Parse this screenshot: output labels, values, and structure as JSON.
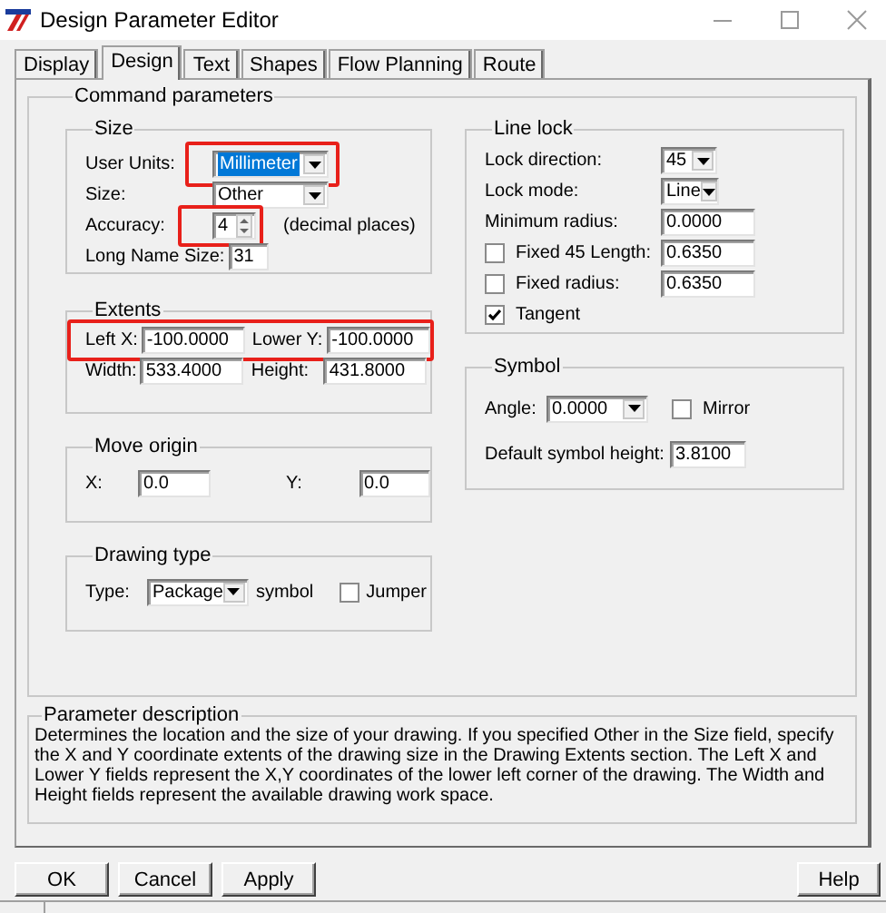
{
  "window": {
    "title": "Design Parameter Editor"
  },
  "tabs": [
    {
      "label": "Display",
      "selected": false
    },
    {
      "label": "Design",
      "selected": true
    },
    {
      "label": "Text",
      "selected": false
    },
    {
      "label": "Shapes",
      "selected": false
    },
    {
      "label": "Flow Planning",
      "selected": false
    },
    {
      "label": "Route",
      "selected": false
    }
  ],
  "command_parameters": {
    "title": "Command parameters"
  },
  "size": {
    "title": "Size",
    "rows": [
      {
        "kind": "dropdown",
        "label": "User Units:",
        "value": "Millimeter",
        "text_selected": true,
        "highlighted": true
      },
      {
        "kind": "dropdown",
        "label": "Size:",
        "value": "Other",
        "text_selected": false,
        "highlighted": false
      },
      {
        "kind": "spinner",
        "label": "Accuracy:",
        "value": "4",
        "suffix": "(decimal places)",
        "highlighted": true
      },
      {
        "kind": "input",
        "label": "Long Name Size:",
        "value": "31",
        "highlighted": false
      }
    ]
  },
  "extents": {
    "title": "Extents",
    "rows": [
      {
        "highlighted": true,
        "fields": [
          {
            "label": "Left X:",
            "value": "-100.0000"
          },
          {
            "label": "Lower Y:",
            "value": "-100.0000"
          }
        ]
      },
      {
        "highlighted": false,
        "fields": [
          {
            "label": "Width:",
            "value": "533.4000"
          },
          {
            "label": "Height:",
            "value": "431.8000"
          }
        ]
      }
    ]
  },
  "move_origin": {
    "title": "Move origin",
    "fields": [
      {
        "label": "X:",
        "value": "0.0"
      },
      {
        "label": "Y:",
        "value": "0.0"
      }
    ]
  },
  "drawing_type": {
    "title": "Drawing type",
    "label": "Type:",
    "value": "Package",
    "suffix": "symbol",
    "jumper": {
      "label": "Jumper",
      "checked": false
    }
  },
  "line_lock": {
    "title": "Line lock",
    "rows": [
      {
        "kind": "dropdown",
        "label": "Lock direction:",
        "value": "45"
      },
      {
        "kind": "dropdown",
        "label": "Lock mode:",
        "value": "Line"
      },
      {
        "kind": "input",
        "label": "Minimum radius:",
        "value": "0.0000"
      },
      {
        "kind": "check_input",
        "label": "Fixed 45 Length:",
        "checked": false,
        "value": "0.6350"
      },
      {
        "kind": "check_input",
        "label": "Fixed radius:",
        "checked": false,
        "value": "0.6350"
      },
      {
        "kind": "check",
        "label": "Tangent",
        "checked": true
      }
    ]
  },
  "symbol": {
    "title": "Symbol",
    "angle": {
      "label": "Angle:",
      "value": "0.0000"
    },
    "mirror": {
      "label": "Mirror",
      "checked": false
    },
    "height": {
      "label": "Default symbol height:",
      "value": "3.8100"
    }
  },
  "description": {
    "title": "Parameter description",
    "text": "Determines the location and the size of your drawing.  If you specified Other in the Size field, specify the X and Y coordinate extents of the drawing size in the Drawing Extents section. The Left X and Lower Y fields represent the X,Y coordinates of the lower left corner of the drawing.  The Width and Height fields represent the available drawing work space."
  },
  "buttons": [
    {
      "label": "OK"
    },
    {
      "label": "Cancel"
    },
    {
      "label": "Apply"
    }
  ],
  "help_button": {
    "label": "Help"
  }
}
